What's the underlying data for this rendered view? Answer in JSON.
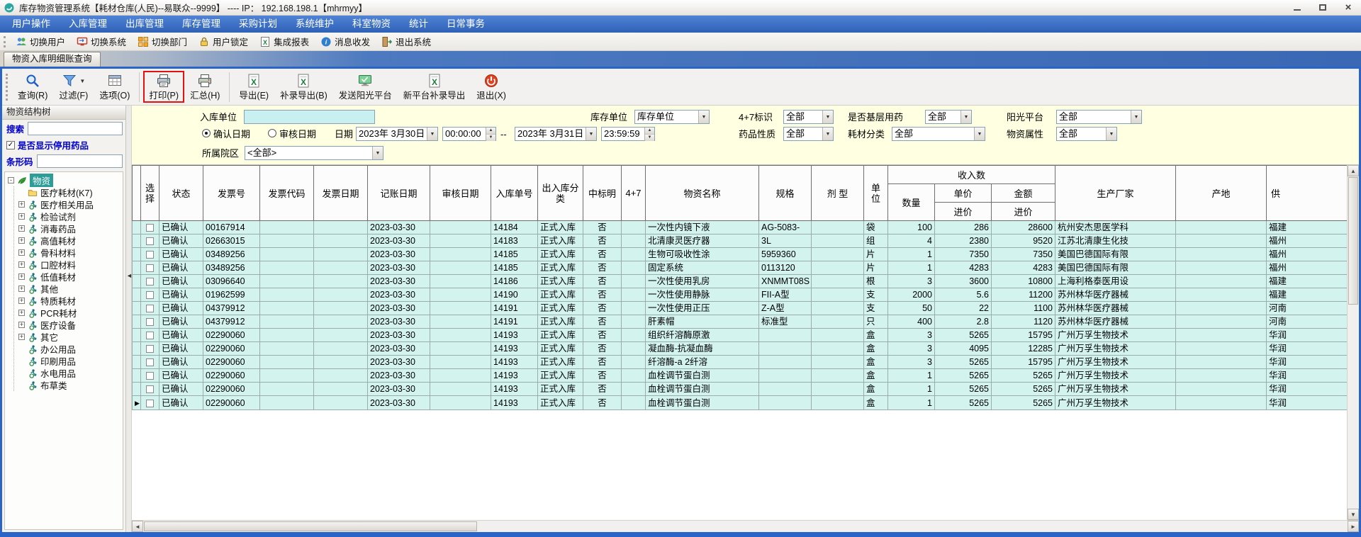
{
  "window": {
    "title": "库存物资管理系统【耗材仓库(人民)--易联众--9999】 ---- IP： 192.168.198.1【mhrmyy】"
  },
  "menu": {
    "items": [
      "用户操作",
      "入库管理",
      "出库管理",
      "库存管理",
      "采购计划",
      "系统维护",
      "科室物资",
      "统计",
      "日常事务"
    ]
  },
  "toolbar": {
    "items": [
      {
        "name": "switch-user",
        "label": "切换用户",
        "icon": "switch-user-icon"
      },
      {
        "name": "switch-system",
        "label": "切换系统",
        "icon": "switch-system-icon"
      },
      {
        "name": "switch-department",
        "label": "切换部门",
        "icon": "switch-department-icon"
      },
      {
        "name": "user-lock",
        "label": "用户锁定",
        "icon": "user-lock-icon"
      },
      {
        "name": "integrated-report",
        "label": "集成报表",
        "icon": "integrated-report-icon"
      },
      {
        "name": "message",
        "label": "消息收发",
        "icon": "message-icon"
      },
      {
        "name": "exit-system",
        "label": "退出系统",
        "icon": "exit-system-icon"
      }
    ]
  },
  "tabs": {
    "active": "物资入库明细账查询"
  },
  "commands": {
    "buttons": [
      {
        "type": "button",
        "name": "query",
        "label": "查询(R)",
        "icon": "search-icon"
      },
      {
        "type": "button",
        "name": "filter",
        "label": "过滤(F)",
        "icon": "filter-icon",
        "dropdown": true
      },
      {
        "type": "button",
        "name": "options",
        "label": "选项(O)",
        "icon": "options-icon"
      },
      {
        "type": "separator"
      },
      {
        "type": "button",
        "name": "print",
        "label": "打印(P)",
        "icon": "print-icon",
        "highlighted": true
      },
      {
        "type": "button",
        "name": "summarize",
        "label": "汇总(H)",
        "icon": "summary-icon"
      },
      {
        "type": "separator"
      },
      {
        "type": "button",
        "name": "export",
        "label": "导出(E)",
        "icon": "excel-export-icon"
      },
      {
        "type": "button",
        "name": "supplement-export",
        "label": "补录导出(B)",
        "icon": "excel-export-icon"
      },
      {
        "type": "button",
        "name": "send-sunshine-platform",
        "label": "发送阳光平台",
        "icon": "send-platform-icon"
      },
      {
        "type": "button",
        "name": "new-platform-supplement-export",
        "label": "新平台补录导出",
        "icon": "excel-export-icon"
      },
      {
        "type": "button",
        "name": "exit",
        "label": "退出(X)",
        "icon": "exit-icon"
      }
    ]
  },
  "sidebar": {
    "header": "物资结构树",
    "search_label": "搜索",
    "search_value": "",
    "show_disabled_label": "是否显示停用药品",
    "show_disabled_checked": true,
    "barcode_label": "条形码",
    "barcode_value": "",
    "tree": {
      "root_label": "物资",
      "items": [
        {
          "label": "医疗耗材(K7)",
          "icon": "folder-icon",
          "expandable": false
        },
        {
          "label": "医疗相关用品",
          "icon": "category-icon",
          "expandable": true
        },
        {
          "label": "检验试剂",
          "icon": "category-icon",
          "expandable": true
        },
        {
          "label": "消毒药品",
          "icon": "category-icon",
          "expandable": true
        },
        {
          "label": "高值耗材",
          "icon": "category-icon",
          "expandable": true
        },
        {
          "label": "骨科材料",
          "icon": "category-icon",
          "expandable": true
        },
        {
          "label": "口腔材料",
          "icon": "category-icon",
          "expandable": true
        },
        {
          "label": "低值耗材",
          "icon": "category-icon",
          "expandable": true
        },
        {
          "label": "其他",
          "icon": "category-icon",
          "expandable": true
        },
        {
          "label": "特质耗材",
          "icon": "category-icon",
          "expandable": true
        },
        {
          "label": "PCR耗材",
          "icon": "category-icon",
          "expandable": true
        },
        {
          "label": "医疗设备",
          "icon": "category-icon",
          "expandable": true
        },
        {
          "label": "其它",
          "icon": "category-icon",
          "expandable": true
        },
        {
          "label": "办公用品",
          "icon": "category-icon",
          "expandable": false
        },
        {
          "label": "印刷用品",
          "icon": "category-icon",
          "expandable": false
        },
        {
          "label": "水电用品",
          "icon": "category-icon",
          "expandable": false
        },
        {
          "label": "布草类",
          "icon": "category-icon",
          "expandable": false
        }
      ]
    }
  },
  "filters": {
    "inbound_unit_label": "入库单位",
    "inbound_unit_value": "",
    "stock_unit_label": "库存单位",
    "stock_unit_value": "库存单位",
    "tag47_label": "4+7标识",
    "tag47_value": "全部",
    "basic_drug_label": "是否基层用药",
    "basic_drug_value": "全部",
    "sunshine_label": "阳光平台",
    "sunshine_value": "全部",
    "confirm_date_label": "确认日期",
    "audit_date_label": "审核日期",
    "date_label": "日期",
    "date_from": "2023年 3月30日",
    "time_from": "00:00:00",
    "range_separator": "--",
    "date_to": "2023年 3月31日",
    "time_to": "23:59:59",
    "drug_nature_label": "药品性质",
    "drug_nature_value": "全部",
    "consumable_class_label": "耗材分类",
    "consumable_class_value": "全部",
    "material_attr_label": "物资属性",
    "material_attr_value": "全部",
    "hospital_area_label": "所属院区",
    "hospital_area_value": "<全部>"
  },
  "grid": {
    "columns": {
      "select": "选择",
      "status": "状态",
      "invoice_no": "发票号",
      "invoice_code": "发票代码",
      "invoice_date": "发票日期",
      "book_date": "记账日期",
      "audit_date": "审核日期",
      "inbound_no": "入库单号",
      "inout_class": "出入库分类",
      "bid": "中标明",
      "tag47": "4+7",
      "name": "物资名称",
      "spec": "规格",
      "dosage": "剂 型",
      "unit": "单位",
      "income_group": "收入数",
      "qty": "数量",
      "price": "单价",
      "amount": "金额",
      "purchase": "进价",
      "manufacturer": "生产厂家",
      "origin": "产地",
      "supplier": "供"
    },
    "current_row_index": 13,
    "rows": [
      {
        "status": "已确认",
        "invoice_no": "00167914",
        "invoice_code": "",
        "invoice_date": "",
        "book_date": "2023-03-30",
        "audit_date": "",
        "inbound_no": "14184",
        "inout_class": "正式入库",
        "bid": "否",
        "tag47": "",
        "name": "一次性内镜下液",
        "spec": "AG-5083-",
        "dosage": "",
        "unit": "袋",
        "qty": "100",
        "price": "286",
        "amount": "28600",
        "manufacturer": "杭州安杰思医学科",
        "origin": "",
        "supplier": "福建"
      },
      {
        "status": "已确认",
        "invoice_no": "02663015",
        "invoice_code": "",
        "invoice_date": "",
        "book_date": "2023-03-30",
        "audit_date": "",
        "inbound_no": "14183",
        "inout_class": "正式入库",
        "bid": "否",
        "tag47": "",
        "name": "北清康灵医疗器",
        "spec": "3L",
        "dosage": "",
        "unit": "组",
        "qty": "4",
        "price": "2380",
        "amount": "9520",
        "manufacturer": "江苏北清康生化技",
        "origin": "",
        "supplier": "福州"
      },
      {
        "status": "已确认",
        "invoice_no": "03489256",
        "invoice_code": "",
        "invoice_date": "",
        "book_date": "2023-03-30",
        "audit_date": "",
        "inbound_no": "14185",
        "inout_class": "正式入库",
        "bid": "否",
        "tag47": "",
        "name": "生物可吸收性涂",
        "spec": "5959360",
        "dosage": "",
        "unit": "片",
        "qty": "1",
        "price": "7350",
        "amount": "7350",
        "manufacturer": "美国巴德国际有限",
        "origin": "",
        "supplier": "福州"
      },
      {
        "status": "已确认",
        "invoice_no": "03489256",
        "invoice_code": "",
        "invoice_date": "",
        "book_date": "2023-03-30",
        "audit_date": "",
        "inbound_no": "14185",
        "inout_class": "正式入库",
        "bid": "否",
        "tag47": "",
        "name": "固定系统",
        "spec": "0113120",
        "dosage": "",
        "unit": "片",
        "qty": "1",
        "price": "4283",
        "amount": "4283",
        "manufacturer": "美国巴德国际有限",
        "origin": "",
        "supplier": "福州"
      },
      {
        "status": "已确认",
        "invoice_no": "03096640",
        "invoice_code": "",
        "invoice_date": "",
        "book_date": "2023-03-30",
        "audit_date": "",
        "inbound_no": "14186",
        "inout_class": "正式入库",
        "bid": "否",
        "tag47": "",
        "name": "一次性使用乳房",
        "spec": "XNMMT08S",
        "dosage": "",
        "unit": "根",
        "qty": "3",
        "price": "3600",
        "amount": "10800",
        "manufacturer": "上海利格泰医用设",
        "origin": "",
        "supplier": "福建"
      },
      {
        "status": "已确认",
        "invoice_no": "01962599",
        "invoice_code": "",
        "invoice_date": "",
        "book_date": "2023-03-30",
        "audit_date": "",
        "inbound_no": "14190",
        "inout_class": "正式入库",
        "bid": "否",
        "tag47": "",
        "name": "一次性使用静脉",
        "spec": "FII-A型",
        "dosage": "",
        "unit": "支",
        "qty": "2000",
        "price": "5.6",
        "amount": "11200",
        "manufacturer": "苏州林华医疗器械",
        "origin": "",
        "supplier": "福建"
      },
      {
        "status": "已确认",
        "invoice_no": "04379912",
        "invoice_code": "",
        "invoice_date": "",
        "book_date": "2023-03-30",
        "audit_date": "",
        "inbound_no": "14191",
        "inout_class": "正式入库",
        "bid": "否",
        "tag47": "",
        "name": "一次性使用正压",
        "spec": "Z-A型",
        "dosage": "",
        "unit": "支",
        "qty": "50",
        "price": "22",
        "amount": "1100",
        "manufacturer": "苏州林华医疗器械",
        "origin": "",
        "supplier": "河南"
      },
      {
        "status": "已确认",
        "invoice_no": "04379912",
        "invoice_code": "",
        "invoice_date": "",
        "book_date": "2023-03-30",
        "audit_date": "",
        "inbound_no": "14191",
        "inout_class": "正式入库",
        "bid": "否",
        "tag47": "",
        "name": "肝素帽",
        "spec": "标准型",
        "dosage": "",
        "unit": "只",
        "qty": "400",
        "price": "2.8",
        "amount": "1120",
        "manufacturer": "苏州林华医疗器械",
        "origin": "",
        "supplier": "河南"
      },
      {
        "status": "已确认",
        "invoice_no": "02290060",
        "invoice_code": "",
        "invoice_date": "",
        "book_date": "2023-03-30",
        "audit_date": "",
        "inbound_no": "14193",
        "inout_class": "正式入库",
        "bid": "否",
        "tag47": "",
        "name": "组织纤溶酶原激",
        "spec": "",
        "dosage": "",
        "unit": "盒",
        "qty": "3",
        "price": "5265",
        "amount": "15795",
        "manufacturer": "广州万孚生物技术",
        "origin": "",
        "supplier": "华润"
      },
      {
        "status": "已确认",
        "invoice_no": "02290060",
        "invoice_code": "",
        "invoice_date": "",
        "book_date": "2023-03-30",
        "audit_date": "",
        "inbound_no": "14193",
        "inout_class": "正式入库",
        "bid": "否",
        "tag47": "",
        "name": "凝血酶-抗凝血酶",
        "spec": "",
        "dosage": "",
        "unit": "盒",
        "qty": "3",
        "price": "4095",
        "amount": "12285",
        "manufacturer": "广州万孚生物技术",
        "origin": "",
        "supplier": "华润"
      },
      {
        "status": "已确认",
        "invoice_no": "02290060",
        "invoice_code": "",
        "invoice_date": "",
        "book_date": "2023-03-30",
        "audit_date": "",
        "inbound_no": "14193",
        "inout_class": "正式入库",
        "bid": "否",
        "tag47": "",
        "name": "纤溶酶-a 2纤溶",
        "spec": "",
        "dosage": "",
        "unit": "盒",
        "qty": "3",
        "price": "5265",
        "amount": "15795",
        "manufacturer": "广州万孚生物技术",
        "origin": "",
        "supplier": "华润"
      },
      {
        "status": "已确认",
        "invoice_no": "02290060",
        "invoice_code": "",
        "invoice_date": "",
        "book_date": "2023-03-30",
        "audit_date": "",
        "inbound_no": "14193",
        "inout_class": "正式入库",
        "bid": "否",
        "tag47": "",
        "name": "血栓调节蛋白测",
        "spec": "",
        "dosage": "",
        "unit": "盒",
        "qty": "1",
        "price": "5265",
        "amount": "5265",
        "manufacturer": "广州万孚生物技术",
        "origin": "",
        "supplier": "华润"
      },
      {
        "status": "已确认",
        "invoice_no": "02290060",
        "invoice_code": "",
        "invoice_date": "",
        "book_date": "2023-03-30",
        "audit_date": "",
        "inbound_no": "14193",
        "inout_class": "正式入库",
        "bid": "否",
        "tag47": "",
        "name": "血栓调节蛋白测",
        "spec": "",
        "dosage": "",
        "unit": "盒",
        "qty": "1",
        "price": "5265",
        "amount": "5265",
        "manufacturer": "广州万孚生物技术",
        "origin": "",
        "supplier": "华润"
      },
      {
        "status": "已确认",
        "invoice_no": "02290060",
        "invoice_code": "",
        "invoice_date": "",
        "book_date": "2023-03-30",
        "audit_date": "",
        "inbound_no": "14193",
        "inout_class": "正式入库",
        "bid": "否",
        "tag47": "",
        "name": "血栓调节蛋白测",
        "spec": "",
        "dosage": "",
        "unit": "盒",
        "qty": "1",
        "price": "5265",
        "amount": "5265",
        "manufacturer": "广州万孚生物技术",
        "origin": "",
        "supplier": "华润"
      }
    ]
  },
  "icons": {
    "chevron_down": "▼",
    "spinner_up": "▲",
    "spinner_down": "▼",
    "check": "✓",
    "close": "×",
    "scroll_up": "▲",
    "scroll_down": "▼",
    "scroll_left": "◄",
    "scroll_right": "►",
    "row_pointer": "▶",
    "splitter_collapse": "◄",
    "expand_plus": "+",
    "collapse_minus": "-"
  },
  "colors": {
    "frame_accent": "#2a64c8",
    "highlight_box": "#e31212",
    "grid_row_bg": "#d3f3ef",
    "filter_bg": "#ffffe1",
    "menu_bar_blue": "#3a6fc4",
    "tree_selection": "#2f9d97"
  }
}
